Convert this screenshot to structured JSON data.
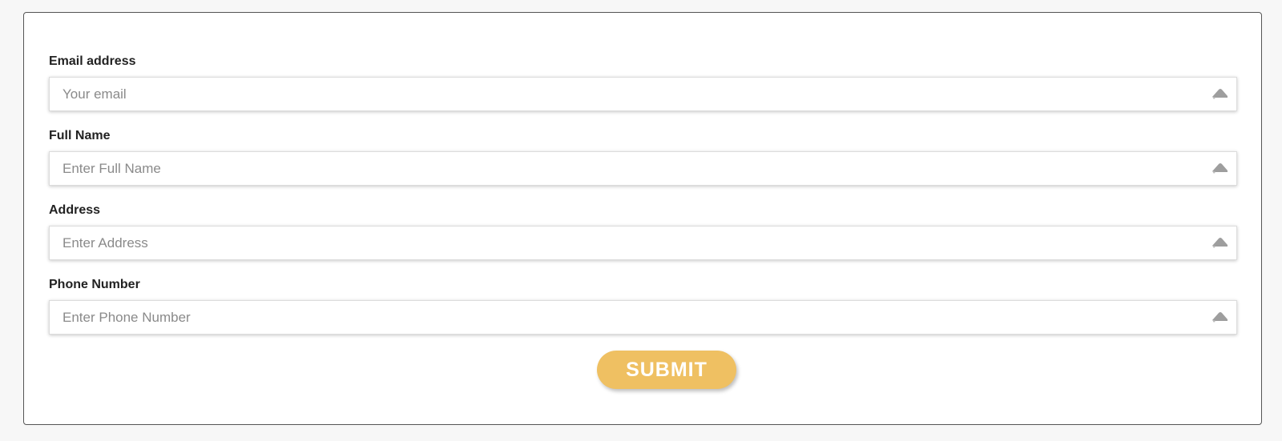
{
  "form": {
    "fields": [
      {
        "label": "Email address",
        "placeholder": "Your email",
        "value": "",
        "icon": "autofill-icon"
      },
      {
        "label": "Full Name",
        "placeholder": "Enter Full Name",
        "value": "",
        "icon": "autofill-icon"
      },
      {
        "label": "Address",
        "placeholder": "Enter Address",
        "value": "",
        "icon": "autofill-icon"
      },
      {
        "label": "Phone Number",
        "placeholder": "Enter Phone Number",
        "value": "",
        "icon": "autofill-icon"
      }
    ],
    "submit_label": "SUBMIT"
  },
  "colors": {
    "page_background": "#f7f7f7",
    "card_border": "#555555",
    "submit_background": "#efc062",
    "submit_text": "#ffffff",
    "label_text": "#222222",
    "placeholder_text": "#8a8a8a",
    "icon": "#9e9e9e"
  }
}
